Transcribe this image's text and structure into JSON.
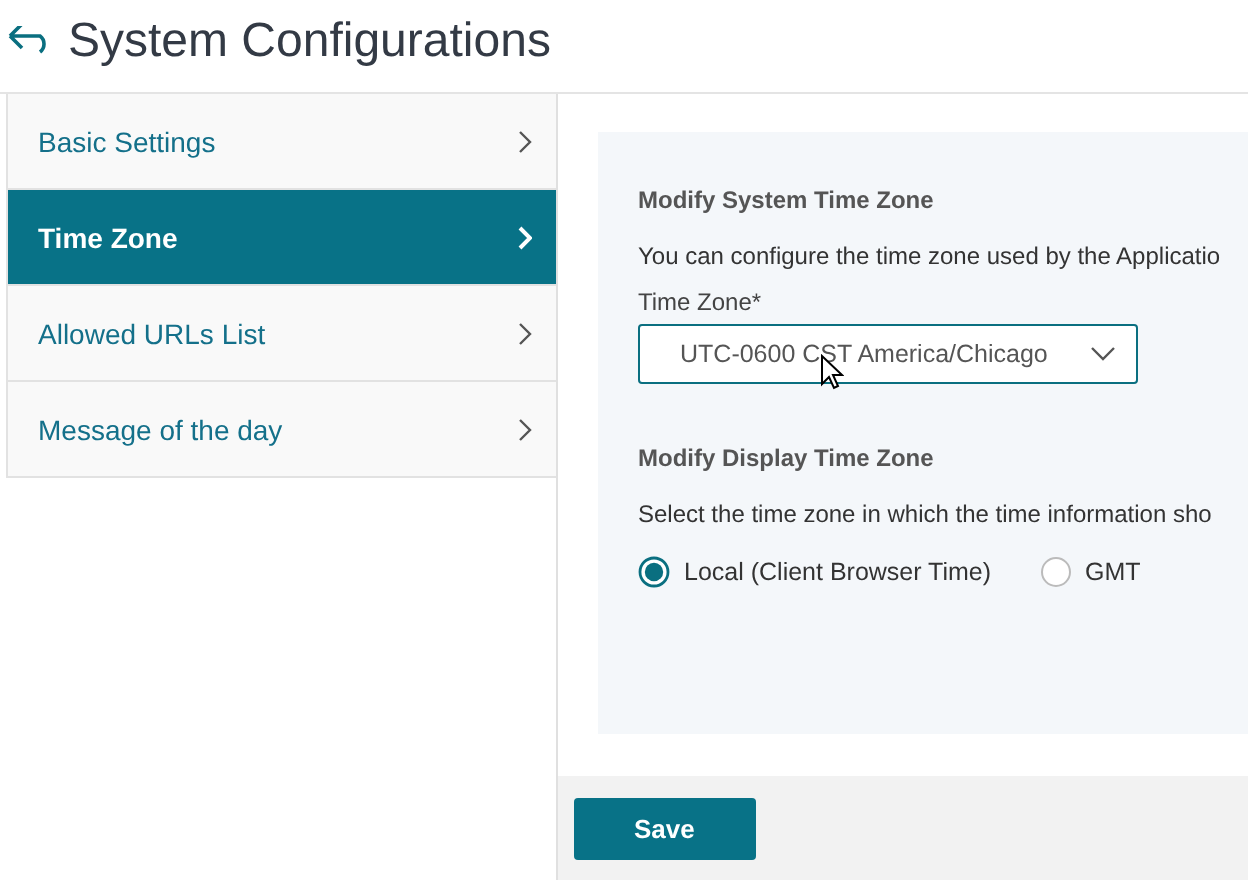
{
  "page": {
    "title": "System Configurations"
  },
  "sidebar": {
    "items": [
      {
        "label": "Basic Settings",
        "selected": false
      },
      {
        "label": "Time Zone",
        "selected": true
      },
      {
        "label": "Allowed URLs List",
        "selected": false
      },
      {
        "label": "Message of the day",
        "selected": false
      }
    ]
  },
  "system_time_zone": {
    "heading": "Modify System Time Zone",
    "description": "You can configure the time zone used by the Applicatio",
    "field_label": "Time Zone*",
    "value": "UTC-0600 CST America/Chicago"
  },
  "display_time_zone": {
    "heading": "Modify Display Time Zone",
    "description": "Select the time zone in which the time information sho",
    "options": [
      {
        "label": "Local (Client Browser Time)",
        "selected": true
      },
      {
        "label": "GMT",
        "selected": false
      }
    ]
  },
  "buttons": [
    "Save"
  ]
}
